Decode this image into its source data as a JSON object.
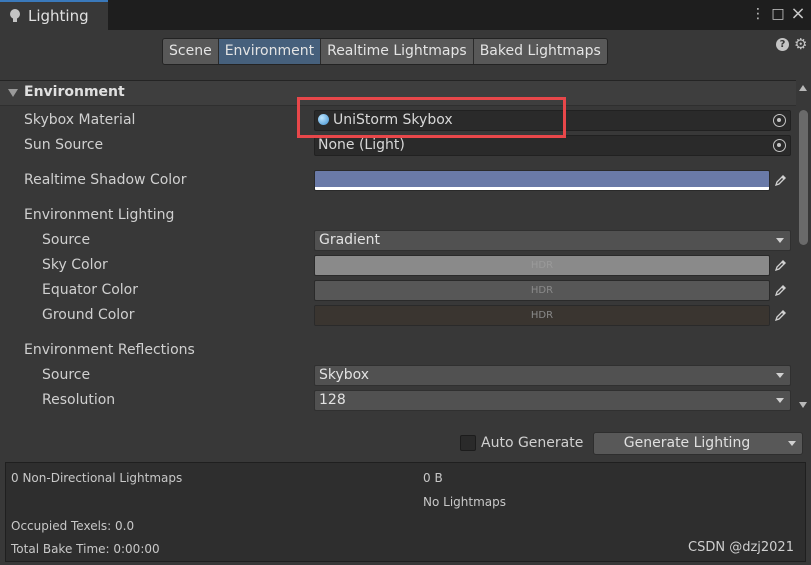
{
  "window": {
    "tab_title": "Lighting",
    "menu_glyph": "⋮",
    "maximize_glyph": "□",
    "close_glyph": "×"
  },
  "toolbar": {
    "tabs": [
      {
        "label": "Scene",
        "active": false
      },
      {
        "label": "Environment",
        "active": true
      },
      {
        "label": "Realtime Lightmaps",
        "active": false
      },
      {
        "label": "Baked Lightmaps",
        "active": false
      }
    ],
    "help_glyph": "?",
    "settings_glyph": "⚙"
  },
  "section": {
    "title": "Environment"
  },
  "fields": {
    "skybox_material": {
      "label": "Skybox Material",
      "value": "UniStorm Skybox"
    },
    "sun_source": {
      "label": "Sun Source",
      "value": "None (Light)"
    },
    "realtime_shadow_color": {
      "label": "Realtime Shadow Color",
      "color": "#6a7aa8"
    }
  },
  "environment_lighting": {
    "label": "Environment Lighting",
    "source": {
      "label": "Source",
      "value": "Gradient"
    },
    "sky_color": {
      "label": "Sky Color",
      "color": "#8a8a8a",
      "badge": "HDR"
    },
    "equator_color": {
      "label": "Equator Color",
      "color": "#575757",
      "badge": "HDR"
    },
    "ground_color": {
      "label": "Ground Color",
      "color": "#3a3530",
      "badge": "HDR"
    }
  },
  "environment_reflections": {
    "label": "Environment Reflections",
    "source": {
      "label": "Source",
      "value": "Skybox"
    },
    "resolution": {
      "label": "Resolution",
      "value": "128"
    }
  },
  "bake": {
    "auto_generate_label": "Auto Generate",
    "auto_generate_checked": false,
    "generate_button_label": "Generate Lighting"
  },
  "stats": {
    "lightmaps": "0 Non-Directional Lightmaps",
    "size": "0 B",
    "no_lightmaps": "No Lightmaps",
    "occupied_texels": "Occupied Texels: 0.0",
    "total_bake_time": "Total Bake Time: 0:00:00"
  },
  "watermark": "CSDN @dzj2021",
  "colors": {
    "highlight_border": "#e8474a",
    "active_tab": "#46607c"
  }
}
